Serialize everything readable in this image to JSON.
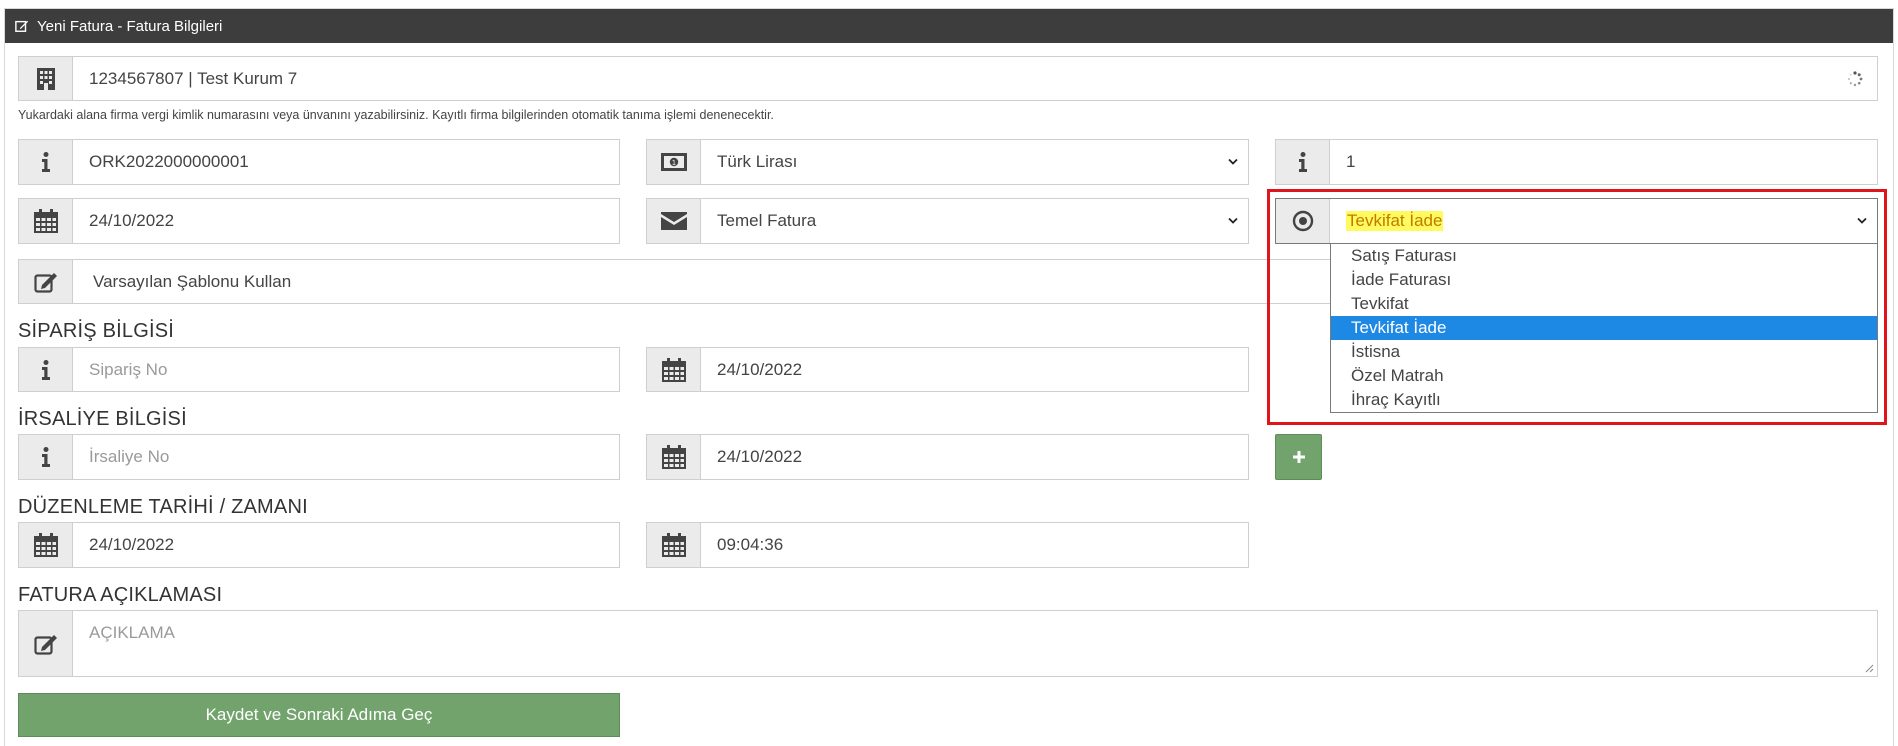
{
  "header": {
    "title": "Yeni Fatura - Fatura Bilgileri"
  },
  "company": {
    "value": "1234567807 | Test Kurum 7"
  },
  "hint": "Yukardaki alana firma vergi kimlik numarasını veya ünvanını yazabilirsiniz. Kayıtlı firma bilgilerinden otomatik tanıma işlemi denenecektir.",
  "row1": {
    "invoice_no": "ORK2022000000001",
    "currency": "Türk Lirası",
    "rate": "1"
  },
  "row2": {
    "date": "24/10/2022",
    "scenario": "Temel Fatura",
    "type_selected": "Tevkifat İade"
  },
  "template": {
    "value": "Varsayılan Şablonu Kullan"
  },
  "invoice_type_options": [
    "Satış Faturası",
    "İade Faturası",
    "Tevkifat",
    "Tevkifat İade",
    "İstisna",
    "Özel Matrah",
    "İhraç Kayıtlı"
  ],
  "order": {
    "section_title": "SİPARİŞ BİLGİSİ",
    "no_placeholder": "Sipariş No",
    "date": "24/10/2022"
  },
  "dispatch": {
    "section_title": "İRSALİYE BİLGİSİ",
    "no_placeholder": "İrsaliye No",
    "date": "24/10/2022"
  },
  "issue": {
    "section_title": "DÜZENLEME TARİHİ / ZAMANI",
    "date": "24/10/2022",
    "time": "09:04:36"
  },
  "description": {
    "section_title": "FATURA AÇIKLAMASI",
    "placeholder": "AÇIKLAMA"
  },
  "actions": {
    "save_label": "Kaydet ve Sonraki Adıma Geç"
  },
  "colors": {
    "header_bg": "#3d3d3d",
    "button_green": "#72a36d",
    "selected_option": "#1e88e5",
    "highlight_box": "#e0151b",
    "text_highlight": "#fffb5e"
  }
}
